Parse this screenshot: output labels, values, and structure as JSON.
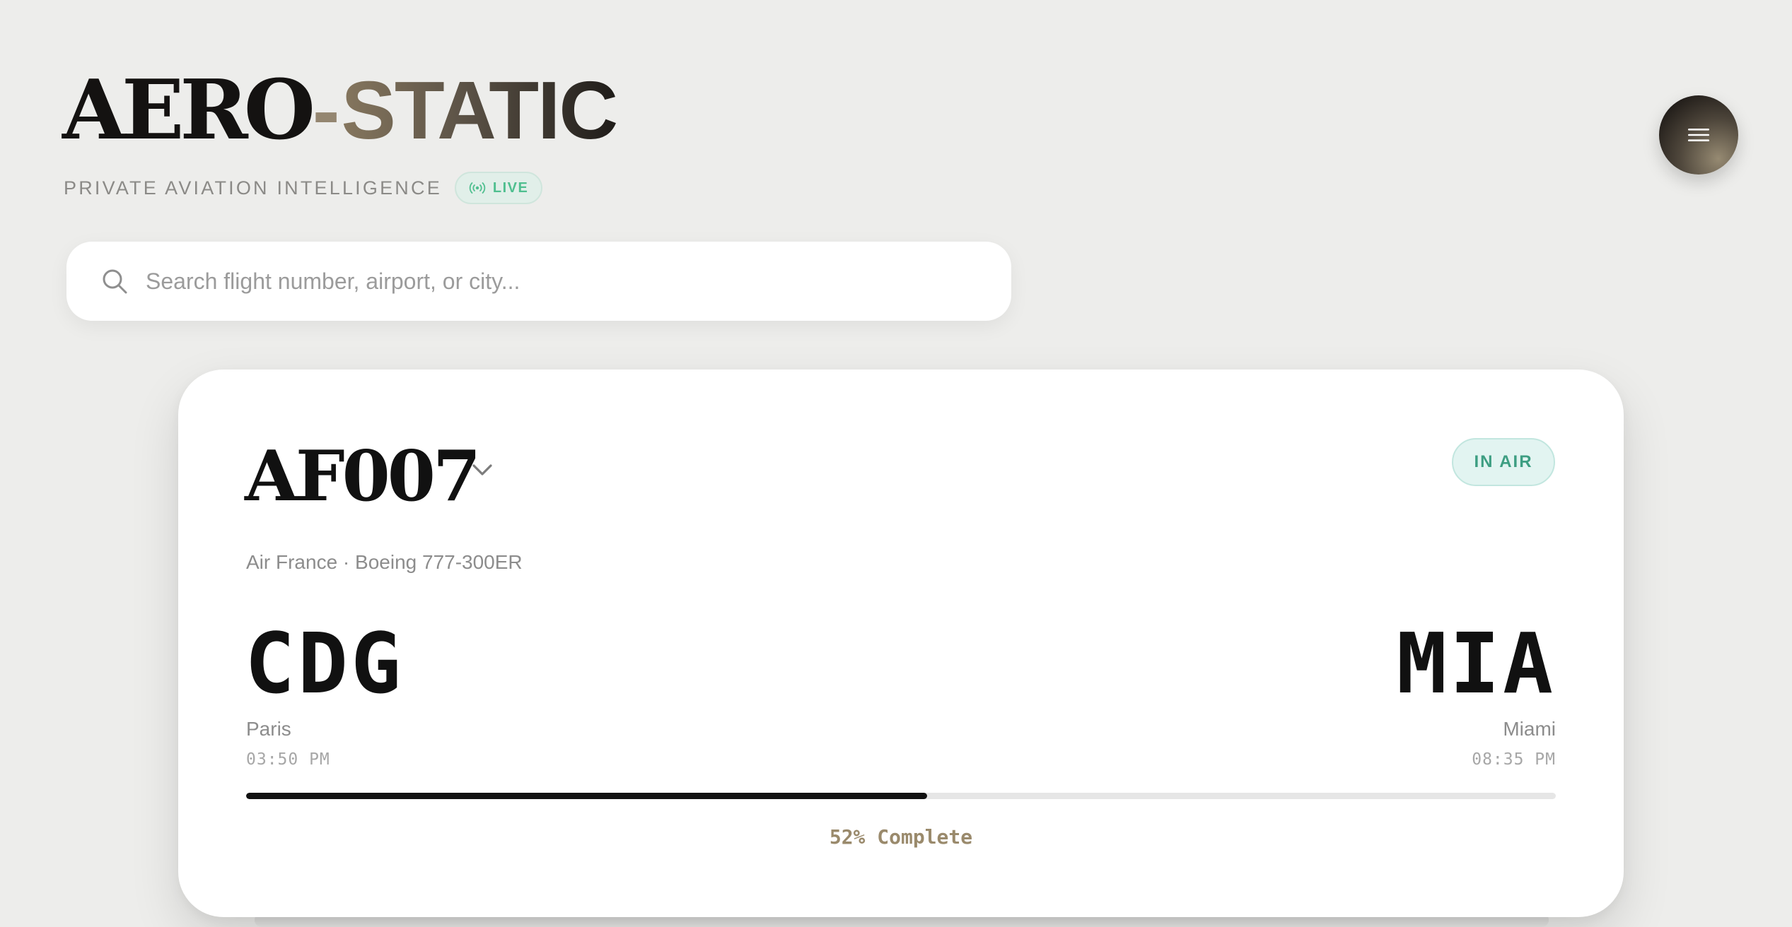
{
  "brand": {
    "part_a": "AERO",
    "separator": "-",
    "part_b": "STATIC",
    "tagline": "PRIVATE AVIATION INTELLIGENCE",
    "live_label": "LIVE"
  },
  "search": {
    "placeholder": "Search flight number, airport, or city...",
    "value": ""
  },
  "menu": {
    "icon": "hamburger-menu-icon"
  },
  "flight": {
    "number": "AF007",
    "status": "IN AIR",
    "aircraft": "Air France · Boeing 777-300ER",
    "origin": {
      "code": "CDG",
      "city": "Paris",
      "time": "03:50 PM"
    },
    "destination": {
      "code": "MIA",
      "city": "Miami",
      "time": "08:35 PM"
    },
    "progress_percent": 52,
    "progress_label": "52% Complete"
  },
  "colors": {
    "background": "#ededeb",
    "live_green": "#4fbf8f",
    "status_teal": "#3d9e82",
    "accent_tan": "#9a8a6c"
  }
}
